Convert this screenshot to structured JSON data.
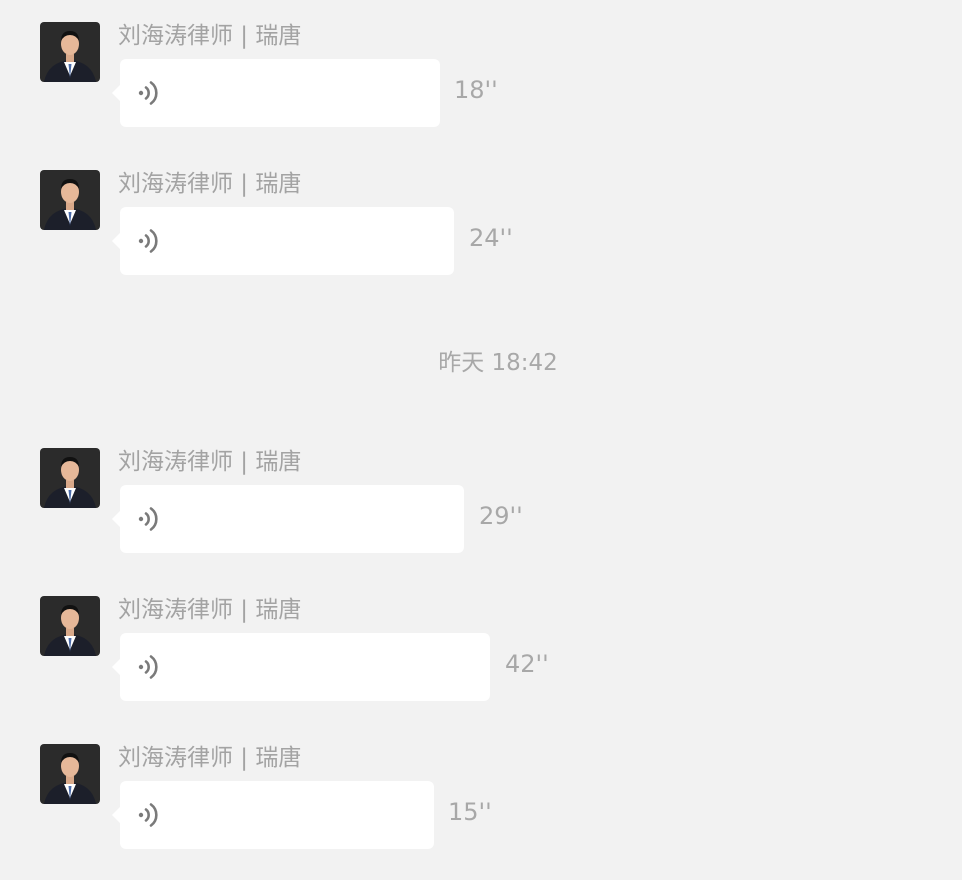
{
  "sender_name": "刘海涛律师 | 瑞唐",
  "timestamp": "昨天 18:42",
  "icons": {
    "avatar": "lawyer-portrait-avatar",
    "voice": "voice-wave-icon"
  },
  "colors": {
    "background": "#f2f2f2",
    "bubble": "#ffffff",
    "muted_text": "#a8a8a8",
    "voice_icon": "#7a7a7a"
  },
  "messages_before": [
    {
      "sender": "刘海涛律师 | 瑞唐",
      "duration": "18''"
    },
    {
      "sender": "刘海涛律师 | 瑞唐",
      "duration": "24''"
    }
  ],
  "messages_after": [
    {
      "sender": "刘海涛律师 | 瑞唐",
      "duration": "29''"
    },
    {
      "sender": "刘海涛律师 | 瑞唐",
      "duration": "42''"
    },
    {
      "sender": "刘海涛律师 | 瑞唐",
      "duration": "15''"
    }
  ]
}
